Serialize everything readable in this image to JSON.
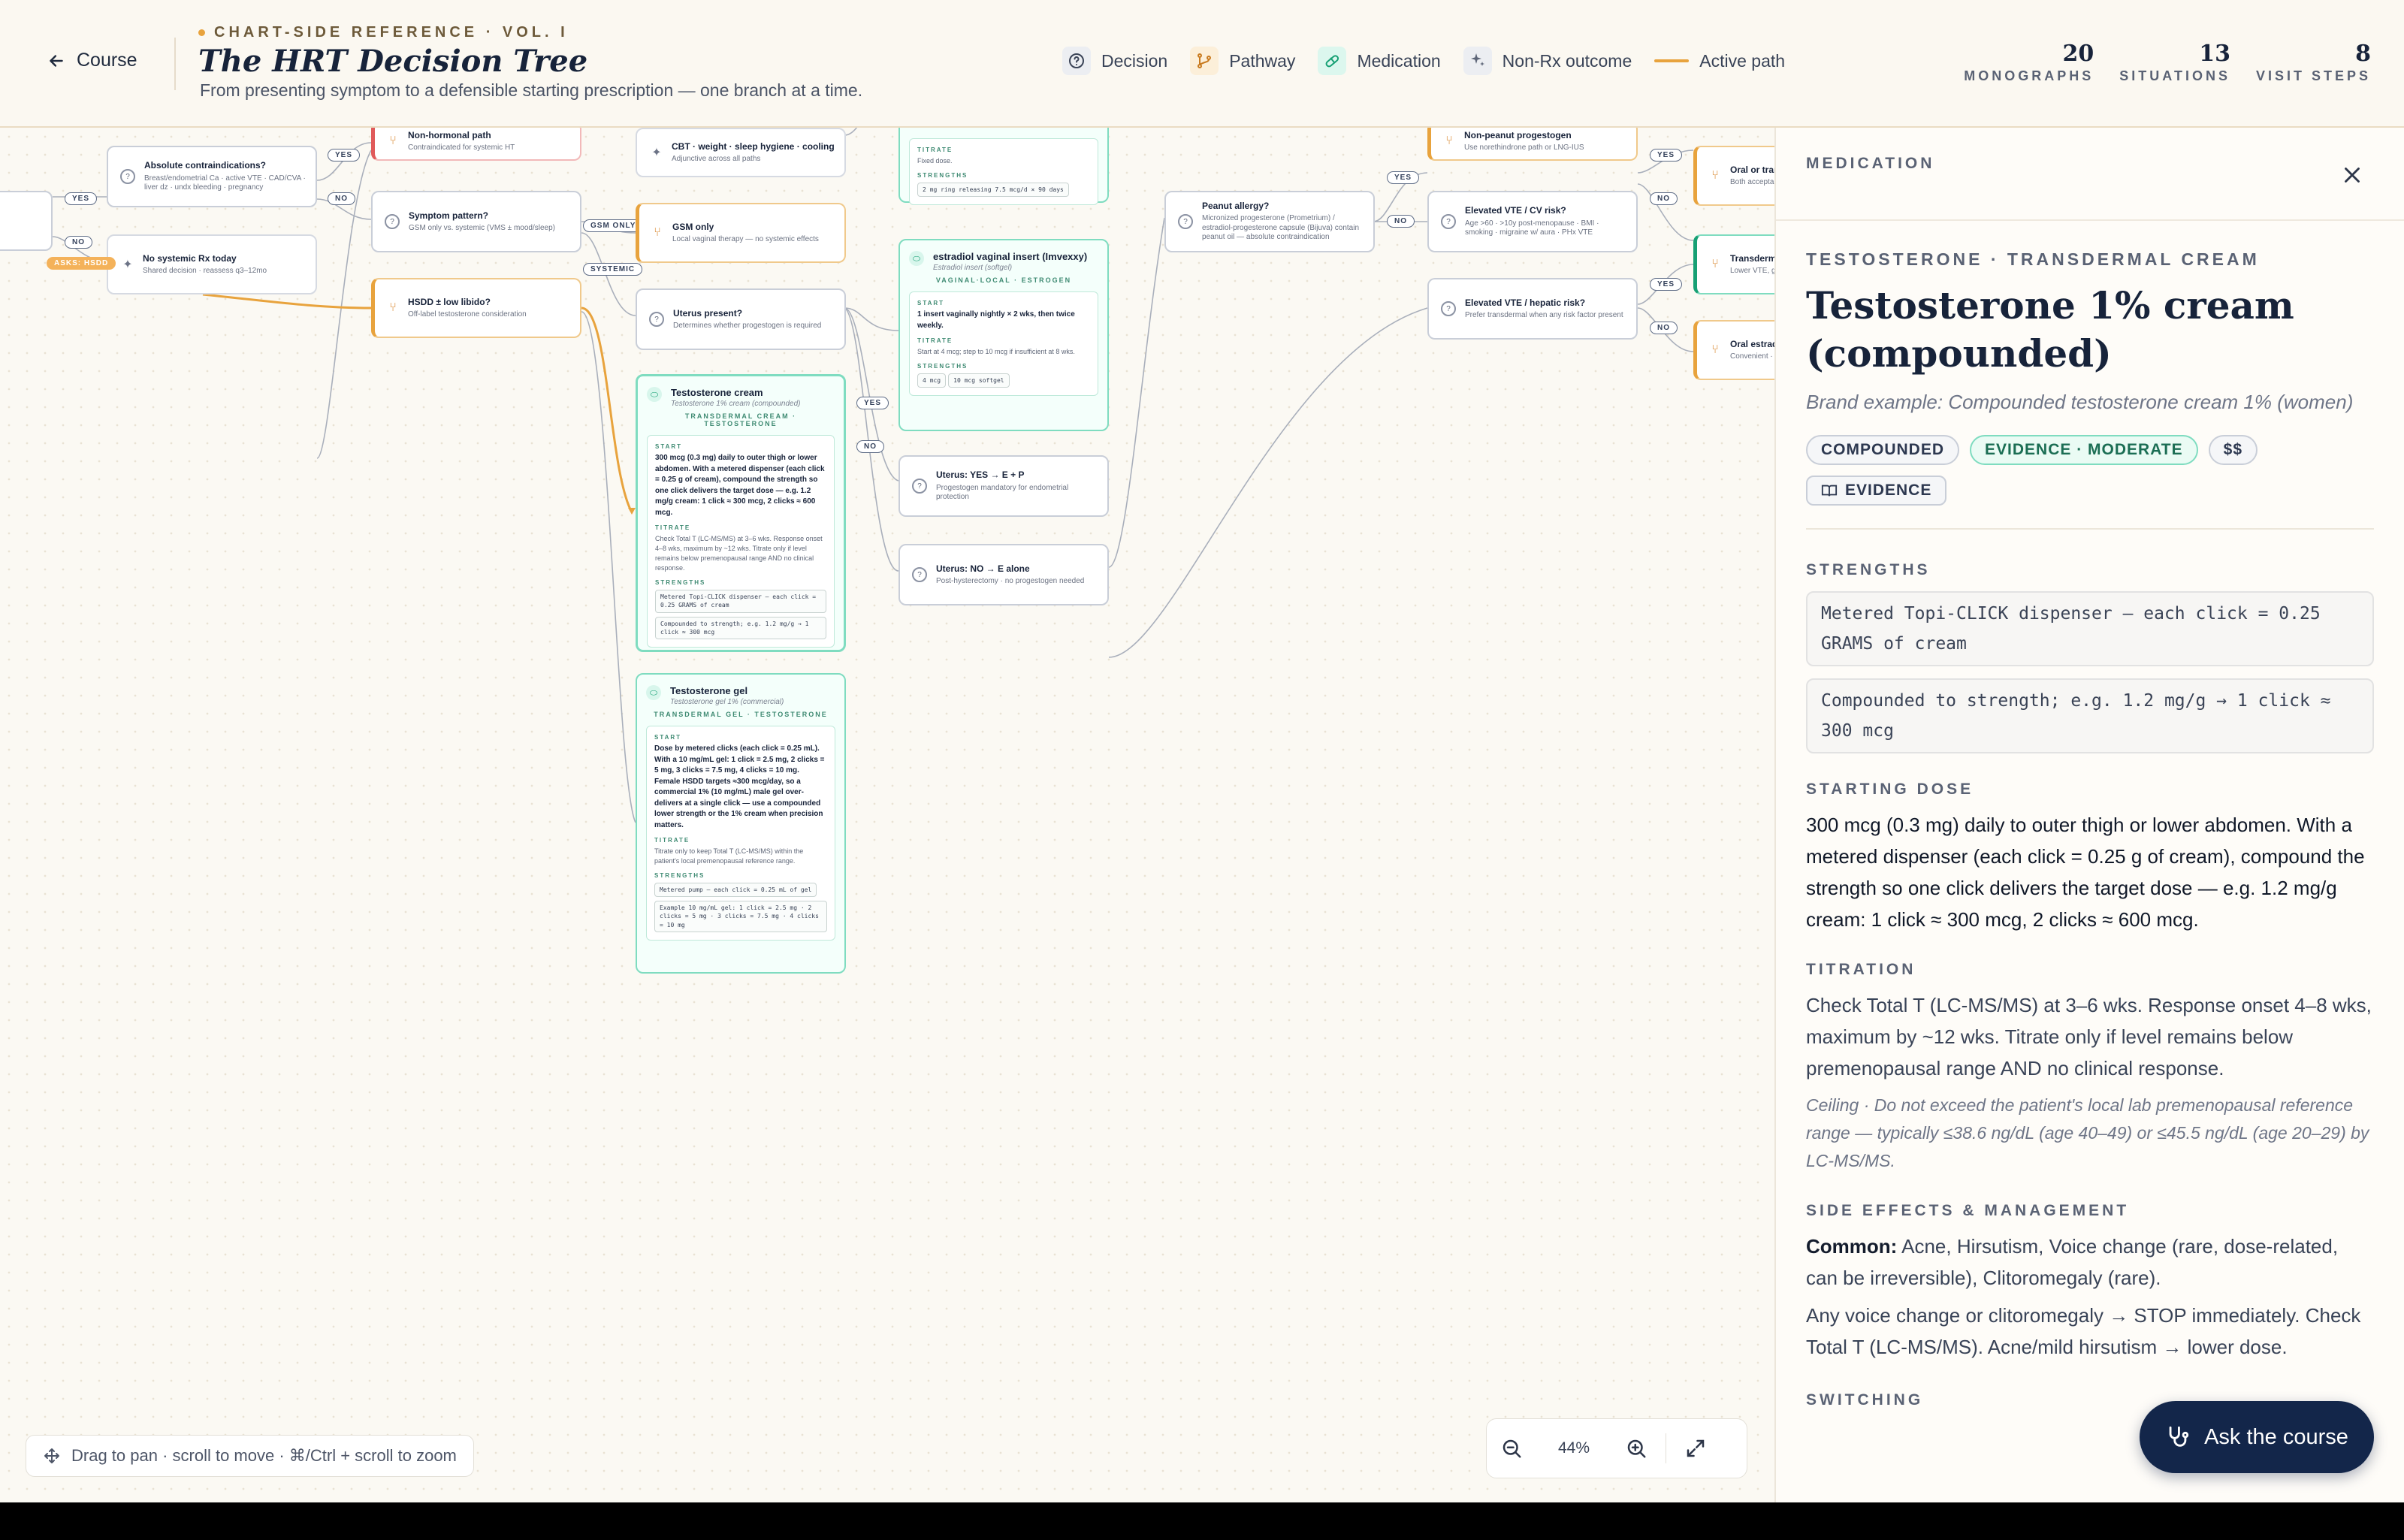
{
  "header": {
    "back_label": "Course",
    "kicker": "CHART-SIDE REFERENCE · VOL. I",
    "title": "The HRT Decision Tree",
    "subtitle": "From presenting symptom to a defensible starting prescription — one branch at a time.",
    "legend": [
      {
        "label": "Decision",
        "icon": "question-circle-icon"
      },
      {
        "label": "Pathway",
        "icon": "branch-icon"
      },
      {
        "label": "Medication",
        "icon": "pill-icon"
      },
      {
        "label": "Non-Rx outcome",
        "icon": "sparkle-icon"
      },
      {
        "label": "Active path",
        "icon": "line-icon"
      }
    ],
    "stats": [
      {
        "value": "20",
        "label": "MONOGRAPHS"
      },
      {
        "value": "13",
        "label": "SITUATIONS"
      },
      {
        "value": "8",
        "label": "VISIT STEPS"
      }
    ]
  },
  "tree": {
    "nodes": {
      "absolute_ci": {
        "title": "Absolute contraindications?",
        "sub": "Breast/endometrial Ca · active VTE · CAD/CVA · liver dz · undx bleeding · pregnancy"
      },
      "no_systemic": {
        "title": "No systemic Rx today",
        "sub": "Shared decision · reassess q3–12mo"
      },
      "nonhormonal": {
        "title": "Non-hormonal path",
        "sub": "Contraindicated for systemic HT"
      },
      "symptom_pattern": {
        "title": "Symptom pattern?",
        "sub": "GSM only vs. systemic (VMS ± mood/sleep)"
      },
      "hsdd": {
        "title": "HSDD ± low libido?",
        "sub": "Off-label testosterone consideration"
      },
      "cbt": {
        "title": "CBT · weight · sleep hygiene · cooling",
        "sub": "Adjunctive across all paths"
      },
      "gsm_only": {
        "title": "GSM only",
        "sub": "Local vaginal therapy — no systemic effects"
      },
      "uterus_present": {
        "title": "Uterus present?",
        "sub": "Determines whether progestogen is required"
      },
      "uterus_yes": {
        "title": "Uterus: YES → E + P",
        "sub": "Progestogen mandatory for endometrial protection"
      },
      "uterus_no": {
        "title": "Uterus: NO → E alone",
        "sub": "Post-hysterectomy · no progestogen needed"
      },
      "peanut": {
        "title": "Peanut allergy?",
        "sub": "Micronized progesterone (Prometrium) / estradiol-progesterone capsule (Bijuva) contain peanut oil — absolute contraindication"
      },
      "nonpeanut": {
        "title": "Non-peanut progestogen",
        "sub": "Use norethindrone path or LNG-IUS"
      },
      "vte_cv": {
        "title": "Elevated VTE / CV risk?",
        "sub": "Age >60 · >10y post-menopause · BMI · smoking · migraine w/ aura · PHx VTE"
      },
      "vte_hepatic": {
        "title": "Elevated VTE / hepatic risk?",
        "sub": "Prefer transdermal when any risk factor present"
      },
      "oral_or_trans": {
        "title": "Oral or trans",
        "sub": "Both acceptable"
      },
      "transdermal": {
        "title": "Transdermal",
        "sub": "Lower VTE, gall"
      },
      "oral_estradiol": {
        "title": "Oral estradio",
        "sub": "Convenient · fir"
      }
    },
    "ring_card": {
      "titrate_label": "TITRATE",
      "titrate": "Fixed dose.",
      "strengths_label": "STRENGTHS",
      "chips": [
        "2 mg ring releasing 7.5 mcg/d × 90 days"
      ]
    },
    "insert_card": {
      "title": "estradiol vaginal insert (Imvexxy)",
      "brand": "Estradiol insert (softgel)",
      "category": "VAGINAL·LOCAL · ESTROGEN",
      "start_label": "START",
      "start": "1 insert vaginally nightly × 2 wks, then twice weekly.",
      "titrate_label": "TITRATE",
      "titrate": "Start at 4 mcg; step to 10 mcg if insufficient at 8 wks.",
      "strengths_label": "STRENGTHS",
      "chips": [
        "4 mcg",
        "10 mcg softgel"
      ]
    },
    "cream_card": {
      "title": "Testosterone cream",
      "brand": "Testosterone 1% cream (compounded)",
      "category": "TRANSDERMAL CREAM · TESTOSTERONE",
      "start_label": "START",
      "start": "300 mcg (0.3 mg) daily to outer thigh or lower abdomen. With a metered dispenser (each click = 0.25 g of cream), compound the strength so one click delivers the target dose — e.g. 1.2 mg/g cream: 1 click ≈ 300 mcg, 2 clicks ≈ 600 mcg.",
      "titrate_label": "TITRATE",
      "titrate": "Check Total T (LC-MS/MS) at 3–6 wks. Response onset 4–8 wks, maximum by ~12 wks. Titrate only if level remains below premenopausal range AND no clinical response.",
      "strengths_label": "STRENGTHS",
      "chips": [
        "Metered Topi-CLICK dispenser — each click = 0.25 GRAMS of cream",
        "Compounded to strength; e.g. 1.2 mg/g → 1 click ≈ 300 mcg"
      ]
    },
    "gel_card": {
      "title": "Testosterone gel",
      "brand": "Testosterone gel 1% (commercial)",
      "category": "TRANSDERMAL GEL · TESTOSTERONE",
      "start_label": "START",
      "start": "Dose by metered clicks (each click = 0.25 mL). With a 10 mg/mL gel: 1 click = 2.5 mg, 2 clicks = 5 mg, 3 clicks = 7.5 mg, 4 clicks = 10 mg. Female HSDD targets ≈300 mcg/day, so a commercial 1% (10 mg/mL) male gel over-delivers at a single click — use a compounded lower strength or the 1% cream when precision matters.",
      "titrate_label": "TITRATE",
      "titrate": "Titrate only to keep Total T (LC-MS/MS) within the patient's local premenopausal reference range.",
      "strengths_label": "STRENGTHS",
      "chips": [
        "Metered pump — each click = 0.25 mL of gel",
        "Example 10 mg/mL gel: 1 click = 2.5 mg · 2 clicks = 5 mg · 3 clicks = 7.5 mg · 4 clicks = 10 mg"
      ]
    },
    "edge_labels": {
      "yes": "YES",
      "no": "NO",
      "gsm_only": "GSM ONLY",
      "systemic": "SYSTEMIC",
      "active_tag": "ASKS: HSDD"
    }
  },
  "canvas": {
    "hint": "Drag to pan · scroll to move · ⌘/Ctrl + scroll to zoom",
    "zoom_level": "44%"
  },
  "panel": {
    "kind": "MEDICATION",
    "eyebrow": "TESTOSTERONE · TRANSDERMAL CREAM",
    "title": "Testosterone 1% cream (compounded)",
    "brand": "Brand example: Compounded testosterone cream 1% (women)",
    "tags": [
      "COMPOUNDED",
      "EVIDENCE · MODERATE",
      "$$"
    ],
    "evidence_button": "EVIDENCE",
    "strengths_label": "STRENGTHS",
    "strengths": [
      "Metered Topi-CLICK dispenser — each click = 0.25 GRAMS of cream",
      "Compounded to strength; e.g. 1.2 mg/g → 1 click ≈ 300 mcg"
    ],
    "starting_dose_label": "STARTING DOSE",
    "starting_dose": "300 mcg (0.3 mg) daily to outer thigh or lower abdomen. With a metered dispenser (each click = 0.25 g of cream), compound the strength so one click delivers the target dose — e.g. 1.2 mg/g cream: 1 click ≈ 300 mcg, 2 clicks ≈ 600 mcg.",
    "titration_label": "TITRATION",
    "titration": "Check Total T (LC-MS/MS) at 3–6 wks. Response onset 4–8 wks, maximum by ~12 wks. Titrate only if level remains below premenopausal range AND no clinical response.",
    "ceiling": "Ceiling · Do not exceed the patient's local lab premenopausal reference range — typically ≤38.6 ng/dL (age 40–49) or ≤45.5 ng/dL (age 20–29) by LC-MS/MS.",
    "side_effects_label": "SIDE EFFECTS & MANAGEMENT",
    "common_label": "Common:",
    "common": "Acne, Hirsutism, Voice change (rare, dose-related, can be irreversible), Clitoromegaly (rare).",
    "management": "Any voice change or clitoromegaly → STOP immediately. Check Total T (LC-MS/MS). Acne/mild hirsutism → lower dose.",
    "switching_label": "SWITCHING"
  },
  "ask_button": "Ask the course",
  "colors": {
    "accent_orange": "#e8a33d",
    "medication_green": "#7fdcc0",
    "navy": "#13264a"
  }
}
